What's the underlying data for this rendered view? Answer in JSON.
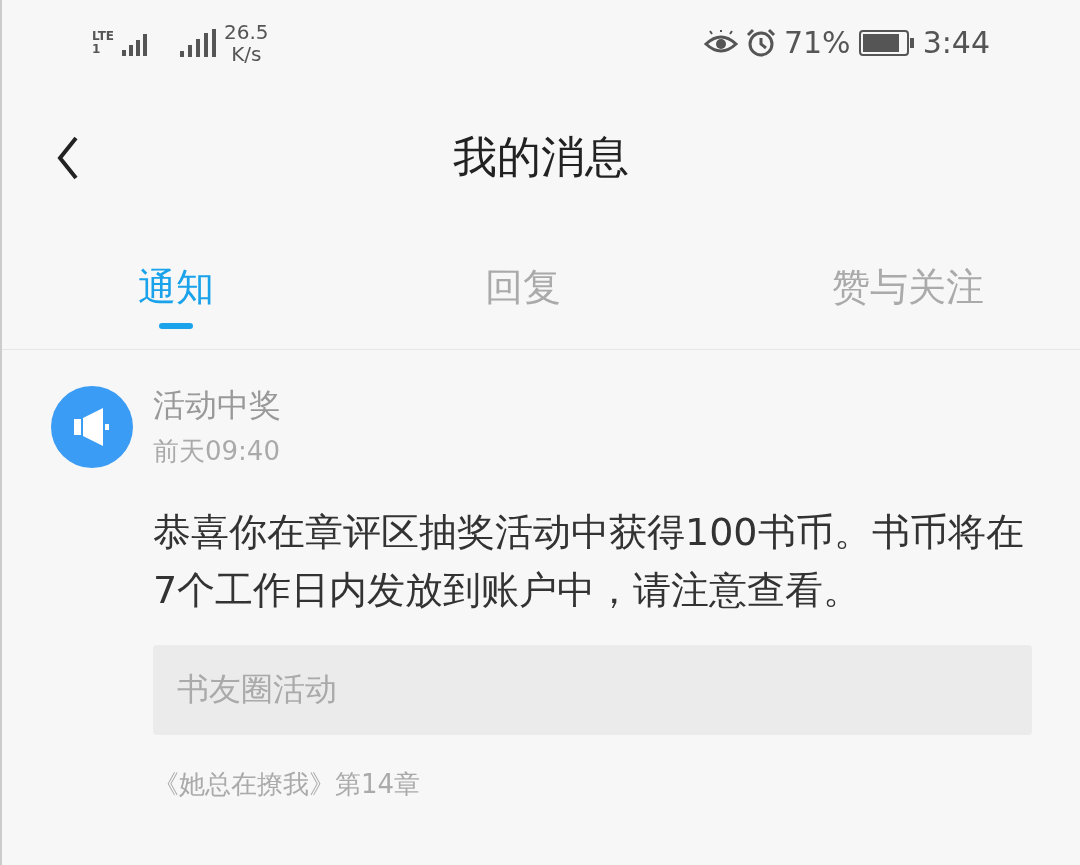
{
  "status_bar": {
    "network": "LTE",
    "sim": "1",
    "speed": "26.5",
    "speed_unit": "K/s",
    "battery": "71%",
    "time": "3:44"
  },
  "header": {
    "title": "我的消息"
  },
  "tabs": [
    {
      "label": "通知",
      "selected": true
    },
    {
      "label": "回复",
      "selected": false
    },
    {
      "label": "赞与关注",
      "selected": false
    }
  ],
  "messages": [
    {
      "title": "活动中奖",
      "time": "前天09:40",
      "body": "恭喜你在章评区抽奖活动中获得100书币。书币将在7个工作日内发放到账户中，请注意查看。",
      "source": "书友圈活动",
      "book": "《她总在撩我》第14章"
    }
  ]
}
